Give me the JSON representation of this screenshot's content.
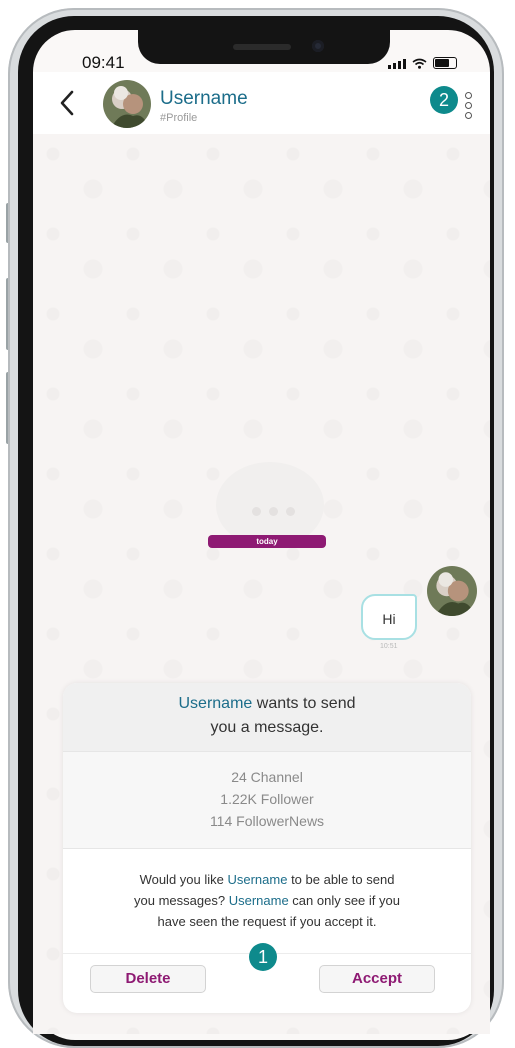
{
  "status_bar": {
    "time": "09:41"
  },
  "header": {
    "username": "Username",
    "profile_tag": "#Profile",
    "badge_2": "2"
  },
  "chat": {
    "date_label": "today",
    "message": {
      "text": "Hi",
      "time": "10:51"
    }
  },
  "request_card": {
    "title_user": "Username",
    "title_rest_1": " wants to send",
    "title_line_2": "you a message.",
    "stats": [
      "24 Channel",
      "1.22K Follower",
      "114 FollowerNews"
    ],
    "question_1a": "Would you like ",
    "question_1b": "Username",
    "question_1c": " to be able to send",
    "question_2b": "Username",
    "question_2a": "you messages? ",
    "question_2c": " can only see if you",
    "question_3": "have seen the request if you accept it.",
    "delete_label": "Delete",
    "accept_label": "Accept",
    "badge_1": "1"
  },
  "colors": {
    "accent_teal": "#0e8a8c",
    "username_blue": "#1c6d8a",
    "brand_purple": "#8e1a73",
    "bubble_border": "#a8e0e3"
  }
}
